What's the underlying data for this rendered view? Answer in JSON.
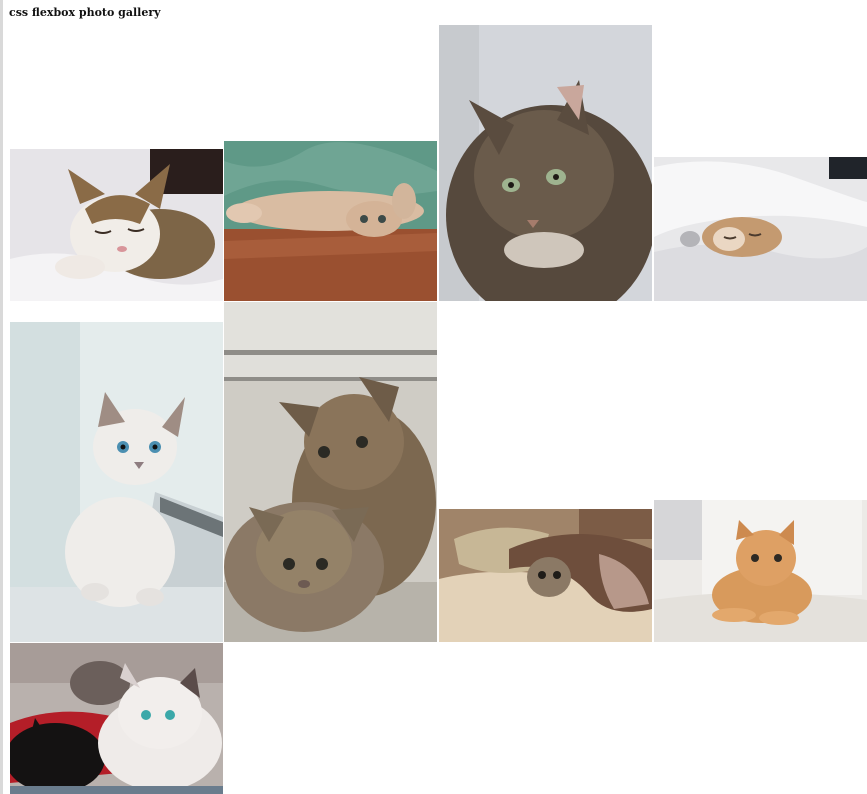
{
  "page": {
    "title": "css flexbox photo gallery"
  },
  "gallery": {
    "photos": [
      {
        "subject": "sleeping tabby-and-white kitten on white blanket",
        "bg": "#e8e6ea",
        "cat": "#8a6a45"
      },
      {
        "subject": "cream kitten lying upside down on wooden floor",
        "bg": "#5f9a87",
        "cat": "#d8b89c"
      },
      {
        "subject": "long-haired gray tabby cat portrait",
        "bg": "#d4d7dc",
        "cat": "#5e5448"
      },
      {
        "subject": "kitten peeking from under white duvet",
        "bg": "#e9e9eb",
        "cat": "#c99a6e"
      },
      {
        "subject": "white siamese kitten with blue eyes by window",
        "bg": "#e3ebec",
        "cat": "#ece9e6"
      },
      {
        "subject": "two tabby kittens on a step",
        "bg": "#d6d2cb",
        "cat": "#7b6650"
      },
      {
        "subject": "tabby kitten hiding under knit blanket on pillow",
        "bg": "#a8876a",
        "cat": "#6f5d4c"
      },
      {
        "subject": "ginger kitten lying on white rug",
        "bg": "#eeeeec",
        "cat": "#d99a5b"
      },
      {
        "subject": "black kitten and white kitten lying together",
        "bg": "#bcb3ae",
        "cat": "#f0ecec"
      }
    ]
  }
}
